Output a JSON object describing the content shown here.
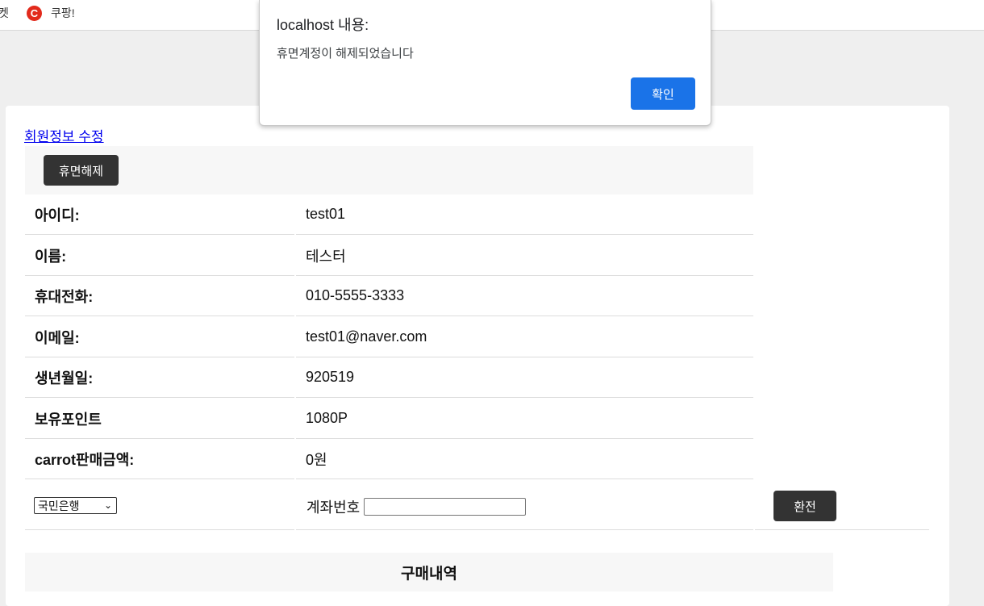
{
  "bookmarks": [
    {
      "label": "켓"
    },
    {
      "label": "쿠팡!",
      "icon": "coupang-logo-icon",
      "icon_glyph": "C"
    }
  ],
  "page": {
    "edit_link": "회원정보 수정",
    "wake_button": "휴면해제",
    "rows": [
      {
        "label": "아이디:",
        "value": "test01"
      },
      {
        "label": "이름:",
        "value": "테스터"
      },
      {
        "label": "휴대전화:",
        "value": "010-5555-3333"
      },
      {
        "label": "이메일:",
        "value": "test01@naver.com"
      },
      {
        "label": "생년월일:",
        "value": "920519"
      },
      {
        "label": "보유포인트",
        "value": "1080P"
      },
      {
        "label": "carrot판매금액:",
        "value": "0원"
      }
    ],
    "bank": {
      "selected": "국민은행"
    },
    "account_label": "계좌번호",
    "account_value": "",
    "exchange_button": "환전",
    "purchase_header": "구매내역"
  },
  "dialog": {
    "title": "localhost 내용:",
    "message": "휴면계정이 해제되었습니다",
    "ok_button": "확인"
  },
  "colors": {
    "dark_button": "#333333",
    "dialog_button": "#1a73e8",
    "link": "#0000ee"
  }
}
